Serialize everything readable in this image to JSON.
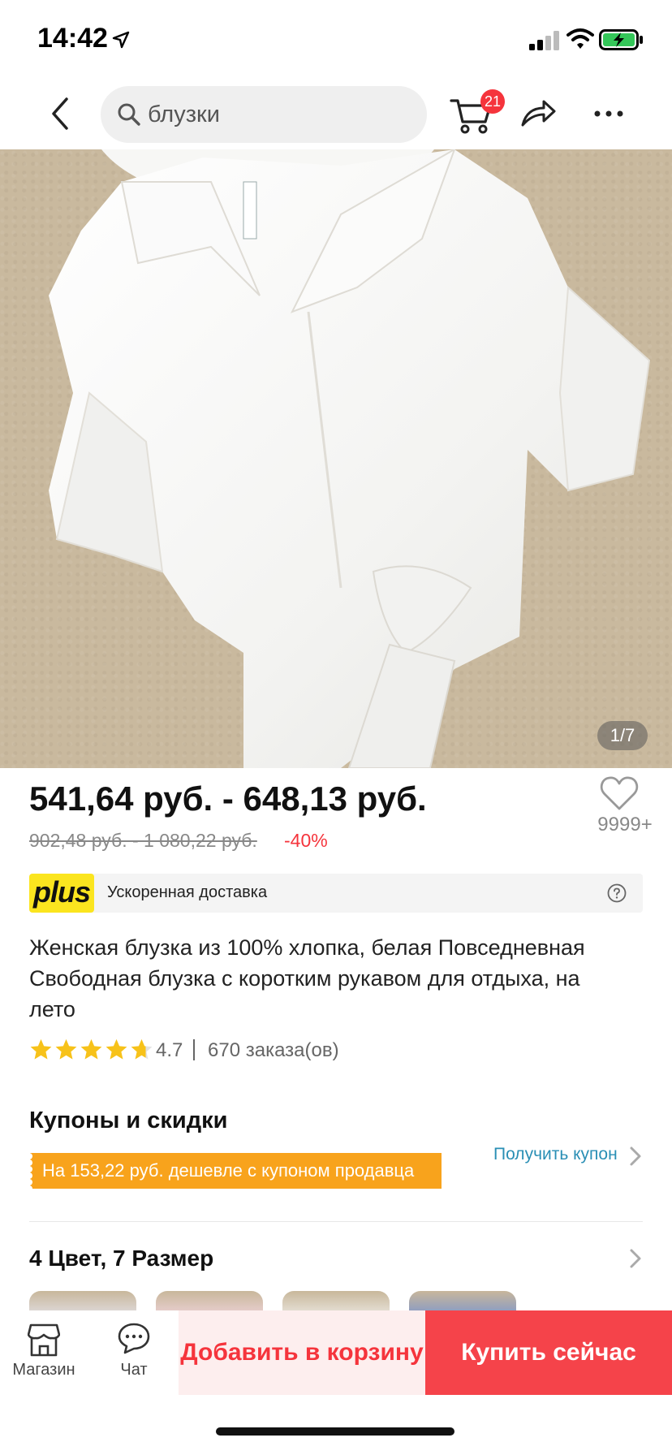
{
  "status_bar": {
    "time": "14:42"
  },
  "nav": {
    "search_text": "блузки",
    "cart_badge": "21"
  },
  "image": {
    "counter": "1/7"
  },
  "price": {
    "range": "541,64 руб. - 648,13 руб.",
    "old_range": "902,48 руб. - 1 080,22 руб.",
    "discount": "-40%",
    "wishlist_count": "9999+"
  },
  "plus": {
    "logo": "plus",
    "text": "Ускоренная доставка"
  },
  "product": {
    "title": "Женская блузка из 100% хлопка, белая Повседневная Свободная блузка с коротким рукавом для отдыха, на лето",
    "rating": "4.7",
    "rating_value": 4.7,
    "orders": "670 заказа(ов)"
  },
  "coupons": {
    "title": "Купоны и скидки",
    "strip_text": "На 153,22 руб. дешевле с купоном продавца",
    "get_coupon": "Получить купон"
  },
  "variants": {
    "title": "4 Цвет, 7 Размер"
  },
  "bottom_bar": {
    "shop_label": "Магазин",
    "chat_label": "Чат",
    "add_to_cart": "Добавить в корзину",
    "buy_now": "Купить сейчас"
  },
  "colors": {
    "accent_red": "#f5343c",
    "coupon_orange": "#f8a31c",
    "plus_yellow": "#fbe51f",
    "link_blue": "#2a8fb5",
    "star_yellow": "#f7c21a"
  }
}
